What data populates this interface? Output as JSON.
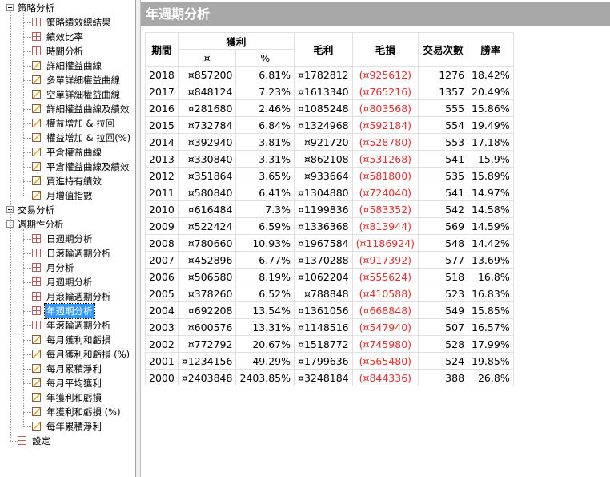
{
  "tree": {
    "groups": [
      {
        "label": "策略分析",
        "expanded": true,
        "items": [
          {
            "label": "策略績效總結果",
            "icon": "grid"
          },
          {
            "label": "績效比率",
            "icon": "grid"
          },
          {
            "label": "時間分析",
            "icon": "grid"
          },
          {
            "label": "詳細權益曲線",
            "icon": "chart"
          },
          {
            "label": "多單詳細權益曲線",
            "icon": "chart"
          },
          {
            "label": "空單詳細權益曲線",
            "icon": "chart"
          },
          {
            "label": "詳細權益曲線及績效",
            "icon": "chart"
          },
          {
            "label": "權益增加 & 拉回",
            "icon": "chart"
          },
          {
            "label": "權益增加 & 拉回(%)",
            "icon": "chart"
          },
          {
            "label": "平倉權益曲線",
            "icon": "chart"
          },
          {
            "label": "平倉權益曲線及績效",
            "icon": "chart"
          },
          {
            "label": "買進持有績效",
            "icon": "chart"
          },
          {
            "label": "月增值指數",
            "icon": "chart"
          }
        ]
      },
      {
        "label": "交易分析",
        "expanded": false,
        "items": []
      },
      {
        "label": "週期性分析",
        "expanded": true,
        "items": [
          {
            "label": "日週期分析",
            "icon": "grid"
          },
          {
            "label": "日滾輪週期分析",
            "icon": "grid"
          },
          {
            "label": "月分析",
            "icon": "grid"
          },
          {
            "label": "月週期分析",
            "icon": "grid"
          },
          {
            "label": "月滾輪週期分析",
            "icon": "grid"
          },
          {
            "label": "年週期分析",
            "icon": "grid",
            "selected": true
          },
          {
            "label": "年滾輪週期分析",
            "icon": "grid"
          },
          {
            "label": "每月獲利和虧損",
            "icon": "chart"
          },
          {
            "label": "每月獲利和虧損 (%)",
            "icon": "chart"
          },
          {
            "label": "每月累積淨利",
            "icon": "chart"
          },
          {
            "label": "每月平均獲利",
            "icon": "chart"
          },
          {
            "label": "年獲利和虧損",
            "icon": "chart"
          },
          {
            "label": "年獲利和虧損 (%)",
            "icon": "chart"
          },
          {
            "label": "每年累積淨利",
            "icon": "chart"
          }
        ]
      },
      {
        "label": "設定",
        "leaf": true,
        "icon": "grid"
      }
    ]
  },
  "report": {
    "title": "年週期分析",
    "headers": {
      "period": "期間",
      "profit": "獲利",
      "profit_amount": "¤",
      "profit_pct": "%",
      "gross_profit": "毛利",
      "gross_loss": "毛損",
      "trades": "交易次數",
      "win_rate": "勝率"
    },
    "rows": [
      {
        "year": "2018",
        "amount": "¤857200",
        "pct": "6.81%",
        "gross_profit": "¤1782812",
        "gross_loss": "(¤925612)",
        "trades": "1276",
        "win_rate": "18.42%"
      },
      {
        "year": "2017",
        "amount": "¤848124",
        "pct": "7.23%",
        "gross_profit": "¤1613340",
        "gross_loss": "(¤765216)",
        "trades": "1357",
        "win_rate": "20.49%"
      },
      {
        "year": "2016",
        "amount": "¤281680",
        "pct": "2.46%",
        "gross_profit": "¤1085248",
        "gross_loss": "(¤803568)",
        "trades": "555",
        "win_rate": "15.86%"
      },
      {
        "year": "2015",
        "amount": "¤732784",
        "pct": "6.84%",
        "gross_profit": "¤1324968",
        "gross_loss": "(¤592184)",
        "trades": "554",
        "win_rate": "19.49%"
      },
      {
        "year": "2014",
        "amount": "¤392940",
        "pct": "3.81%",
        "gross_profit": "¤921720",
        "gross_loss": "(¤528780)",
        "trades": "553",
        "win_rate": "17.18%"
      },
      {
        "year": "2013",
        "amount": "¤330840",
        "pct": "3.31%",
        "gross_profit": "¤862108",
        "gross_loss": "(¤531268)",
        "trades": "541",
        "win_rate": "15.9%"
      },
      {
        "year": "2012",
        "amount": "¤351864",
        "pct": "3.65%",
        "gross_profit": "¤933664",
        "gross_loss": "(¤581800)",
        "trades": "535",
        "win_rate": "15.89%"
      },
      {
        "year": "2011",
        "amount": "¤580840",
        "pct": "6.41%",
        "gross_profit": "¤1304880",
        "gross_loss": "(¤724040)",
        "trades": "541",
        "win_rate": "14.97%"
      },
      {
        "year": "2010",
        "amount": "¤616484",
        "pct": "7.3%",
        "gross_profit": "¤1199836",
        "gross_loss": "(¤583352)",
        "trades": "542",
        "win_rate": "14.58%"
      },
      {
        "year": "2009",
        "amount": "¤522424",
        "pct": "6.59%",
        "gross_profit": "¤1336368",
        "gross_loss": "(¤813944)",
        "trades": "569",
        "win_rate": "14.59%"
      },
      {
        "year": "2008",
        "amount": "¤780660",
        "pct": "10.93%",
        "gross_profit": "¤1967584",
        "gross_loss": "(¤1186924)",
        "trades": "548",
        "win_rate": "14.42%"
      },
      {
        "year": "2007",
        "amount": "¤452896",
        "pct": "6.77%",
        "gross_profit": "¤1370288",
        "gross_loss": "(¤917392)",
        "trades": "577",
        "win_rate": "13.69%"
      },
      {
        "year": "2006",
        "amount": "¤506580",
        "pct": "8.19%",
        "gross_profit": "¤1062204",
        "gross_loss": "(¤555624)",
        "trades": "518",
        "win_rate": "16.8%"
      },
      {
        "year": "2005",
        "amount": "¤378260",
        "pct": "6.52%",
        "gross_profit": "¤788848",
        "gross_loss": "(¤410588)",
        "trades": "523",
        "win_rate": "16.83%"
      },
      {
        "year": "2004",
        "amount": "¤692208",
        "pct": "13.54%",
        "gross_profit": "¤1361056",
        "gross_loss": "(¤668848)",
        "trades": "549",
        "win_rate": "15.85%"
      },
      {
        "year": "2003",
        "amount": "¤600576",
        "pct": "13.31%",
        "gross_profit": "¤1148516",
        "gross_loss": "(¤547940)",
        "trades": "507",
        "win_rate": "16.57%"
      },
      {
        "year": "2002",
        "amount": "¤772792",
        "pct": "20.67%",
        "gross_profit": "¤1518772",
        "gross_loss": "(¤745980)",
        "trades": "528",
        "win_rate": "17.99%"
      },
      {
        "year": "2001",
        "amount": "¤1234156",
        "pct": "49.29%",
        "gross_profit": "¤1799636",
        "gross_loss": "(¤565480)",
        "trades": "524",
        "win_rate": "19.85%"
      },
      {
        "year": "2000",
        "amount": "¤2403848",
        "pct": "2403.85%",
        "gross_profit": "¤3248184",
        "gross_loss": "(¤844336)",
        "trades": "388",
        "win_rate": "26.8%"
      }
    ]
  },
  "colors": {
    "title_bar": "#a8a8a8",
    "selection": "#3399ff",
    "loss_text": "#e03030"
  }
}
